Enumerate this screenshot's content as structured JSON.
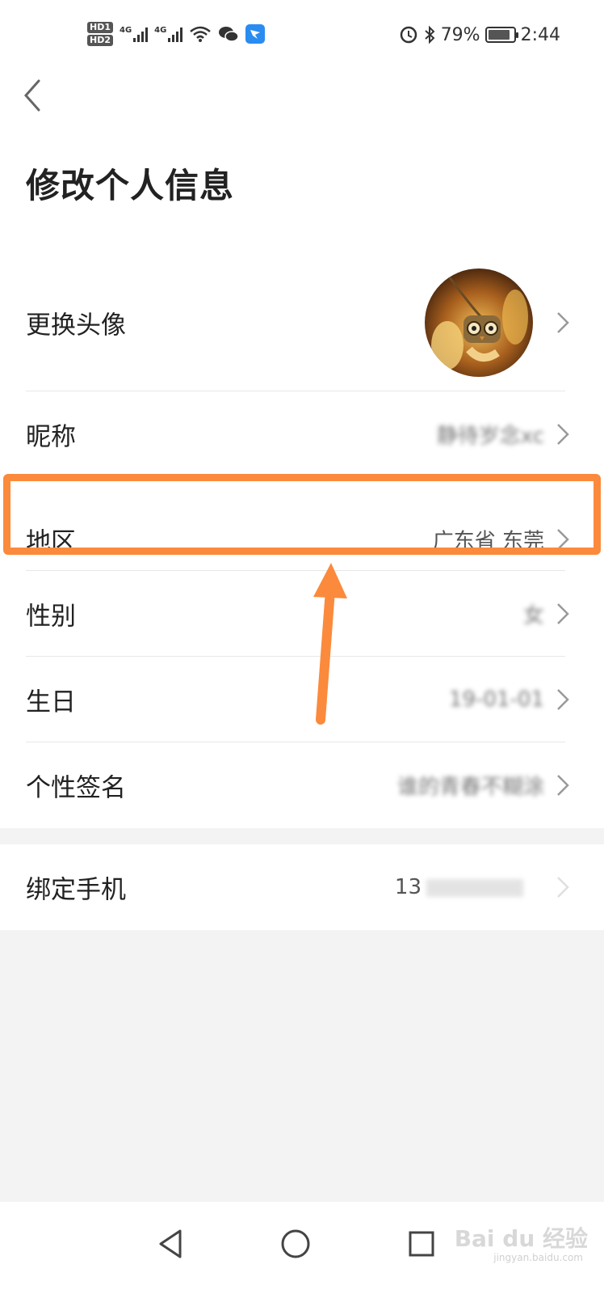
{
  "status_bar": {
    "hd1": "HD",
    "hd1_slot": "1",
    "hd2": "HD",
    "hd2_slot": "2",
    "network1": "4G",
    "network2": "4G",
    "battery_percent": "79%",
    "battery_level": 0.79,
    "time": "2:44"
  },
  "header": {
    "title": "修改个人信息"
  },
  "profile_rows": [
    {
      "label": "更换头像",
      "value": ""
    },
    {
      "label": "昵称",
      "value": "静待岁念xc"
    },
    {
      "label": "地区",
      "value": "广东省 东莞"
    },
    {
      "label": "性别",
      "value": "女"
    },
    {
      "label": "生日",
      "value": "19-01-01"
    },
    {
      "label": "个性签名",
      "value": "谁的青春不糊涂"
    }
  ],
  "phone_row": {
    "label": "绑定手机",
    "value": "13"
  },
  "watermark": {
    "text": "Bai du 经验",
    "sub": "jingyan.baidu.com"
  },
  "colors": {
    "highlight": "#fb8a3c",
    "background": "#f3f3f3"
  },
  "icons": [
    "back-arrow",
    "chevron-right",
    "nav-back-triangle",
    "nav-home-circle",
    "nav-recent-square",
    "wechat",
    "dingtalk",
    "bluetooth",
    "wifi"
  ]
}
